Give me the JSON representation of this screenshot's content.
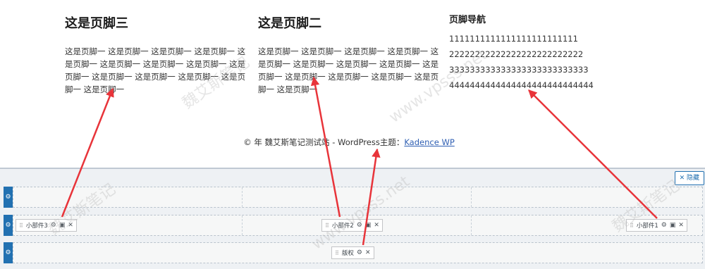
{
  "footer_preview": {
    "col3": {
      "title": "这是页脚三",
      "text": "这是页脚一 这是页脚一 这是页脚一 这是页脚一 这是页脚一 这是页脚一 这是页脚一 这是页脚一 这是页脚一 这是页脚一 这是页脚一 这是页脚一 这是页脚一 这是页脚一"
    },
    "col2": {
      "title": "这是页脚二",
      "text": "这是页脚一 这是页脚一 这是页脚一 这是页脚一 这是页脚一 这是页脚一 这是页脚一 这是页脚一 这是页脚一 这是页脚一 这是页脚一 这是页脚一 这是页脚一 这是页脚一"
    },
    "nav": {
      "title": "页脚导航",
      "items": [
        "1111111111111111111111111",
        "22222222222222222222222222",
        "333333333333333333333333333",
        "4444444444444444444444444444"
      ]
    },
    "copyright": {
      "prefix": "© 年 魏艾斯笔记测试站 - WordPress主题：",
      "link": "Kadence WP"
    }
  },
  "builder": {
    "hide_label": "隐藏",
    "widgets": {
      "w3": "小部件3",
      "w2": "小部件2",
      "w1": "小部件1",
      "copyright": "版权"
    }
  },
  "watermark": {
    "text1": "魏艾斯笔记",
    "text2": "www.vpsss.net"
  },
  "icons": {
    "gear": "gear-icon",
    "close": "close-icon",
    "drag": "drag-handle-icon",
    "dashboard": "dashboard-icon"
  },
  "colors": {
    "accent": "#2271b1",
    "arrow": "#e8343a"
  }
}
